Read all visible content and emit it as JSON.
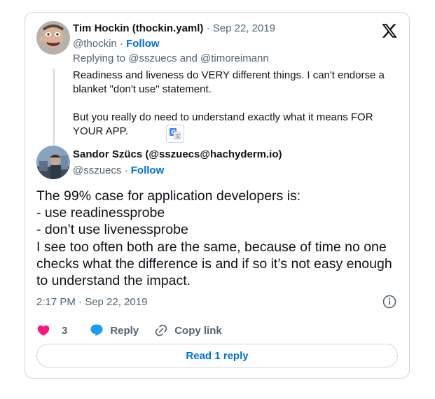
{
  "parent_tweet": {
    "author_name": "Tim Hockin (thockin.yaml)",
    "date": "Sep 22, 2019",
    "handle": "@thockin",
    "follow_label": "Follow",
    "replying_to": "Replying to @sszuecs and @timoreimann",
    "text": "Readiness and liveness do VERY different things.  I can't endorse a blanket \"don't use\" statement.\n\nBut you really do need to understand exactly what it means FOR YOUR APP."
  },
  "main_tweet": {
    "author_name": "Sandor Szücs (@sszuecs@hachyderm.io)",
    "handle": "@sszuecs",
    "follow_label": "Follow",
    "text": "The 99% case for application developers is:\n- use readinessprobe\n- don’t use livenessprobe\nI see too often both are the same, because of time no one checks what the difference is and if so it’s not easy enough to understand the impact.",
    "timestamp": "2:17 PM · Sep 22, 2019"
  },
  "actions": {
    "like_count": "3",
    "reply_label": "Reply",
    "copy_link_label": "Copy link"
  },
  "read_replies_label": "Read 1 reply",
  "colors": {
    "like": "#f91880",
    "reply": "#1d9bf0",
    "link": "#006fd6",
    "muted": "#536471",
    "border": "#cfd9de"
  },
  "icons": [
    "x-logo-icon",
    "translate-icon",
    "info-icon",
    "heart-icon",
    "reply-bubble-icon",
    "link-icon"
  ]
}
